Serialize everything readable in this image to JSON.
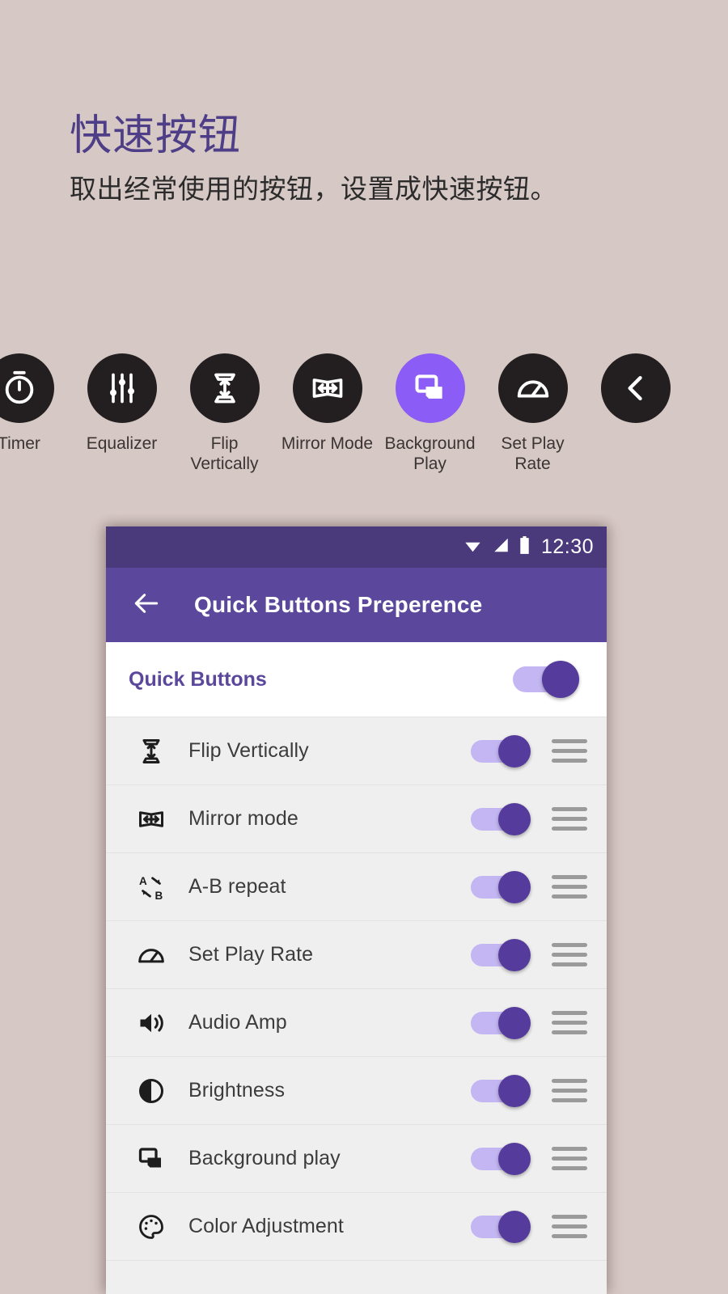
{
  "promo": {
    "title": "快速按钮",
    "subtitle": "取出经常使用的按钮，设置成快速按钮。"
  },
  "colors": {
    "page_background": "#d6c8c5",
    "heading_purple": "#4e3d87",
    "accent_purple": "#8b5cf6",
    "statusbar_purple": "#4a3a7c",
    "appbar_purple": "#5b479b",
    "switch_thumb": "#553b9c",
    "switch_track": "#c3b6f2",
    "icon_circle": "#231f20"
  },
  "icon_strip": [
    {
      "label": "Timer",
      "icon": "timer-icon",
      "highlighted": false,
      "clipped": true
    },
    {
      "label": "Equalizer",
      "icon": "equalizer-icon",
      "highlighted": false,
      "clipped": false
    },
    {
      "label": "Flip Vertically",
      "icon": "flip-vertically-icon",
      "highlighted": false,
      "clipped": false
    },
    {
      "label": "Mirror Mode",
      "icon": "mirror-mode-icon",
      "highlighted": false,
      "clipped": false
    },
    {
      "label": "Background Play",
      "icon": "background-play-icon",
      "highlighted": true,
      "clipped": false
    },
    {
      "label": "Set Play Rate",
      "icon": "set-play-rate-icon",
      "highlighted": false,
      "clipped": false
    },
    {
      "label": "",
      "icon": "chevron-left-icon",
      "highlighted": false,
      "clipped": false
    }
  ],
  "phone": {
    "statusbar": {
      "time": "12:30",
      "icons": [
        "wifi-icon",
        "signal-icon",
        "battery-icon"
      ]
    },
    "appbar": {
      "back_icon": "back-arrow-icon",
      "title": "Quick Buttons Preperence"
    },
    "master": {
      "label": "Quick Buttons",
      "enabled": true
    },
    "rows": [
      {
        "icon": "flip-vertically-icon",
        "label": "Flip Vertically",
        "enabled": true
      },
      {
        "icon": "mirror-mode-icon",
        "label": "Mirror mode",
        "enabled": true
      },
      {
        "icon": "ab-repeat-icon",
        "label": "A-B repeat",
        "enabled": true
      },
      {
        "icon": "set-play-rate-icon",
        "label": "Set Play Rate",
        "enabled": true
      },
      {
        "icon": "audio-amp-icon",
        "label": "Audio Amp",
        "enabled": true
      },
      {
        "icon": "brightness-icon",
        "label": "Brightness",
        "enabled": true
      },
      {
        "icon": "background-play-icon",
        "label": "Background play",
        "enabled": true
      },
      {
        "icon": "color-adjustment-icon",
        "label": "Color Adjustment",
        "enabled": true
      }
    ]
  }
}
